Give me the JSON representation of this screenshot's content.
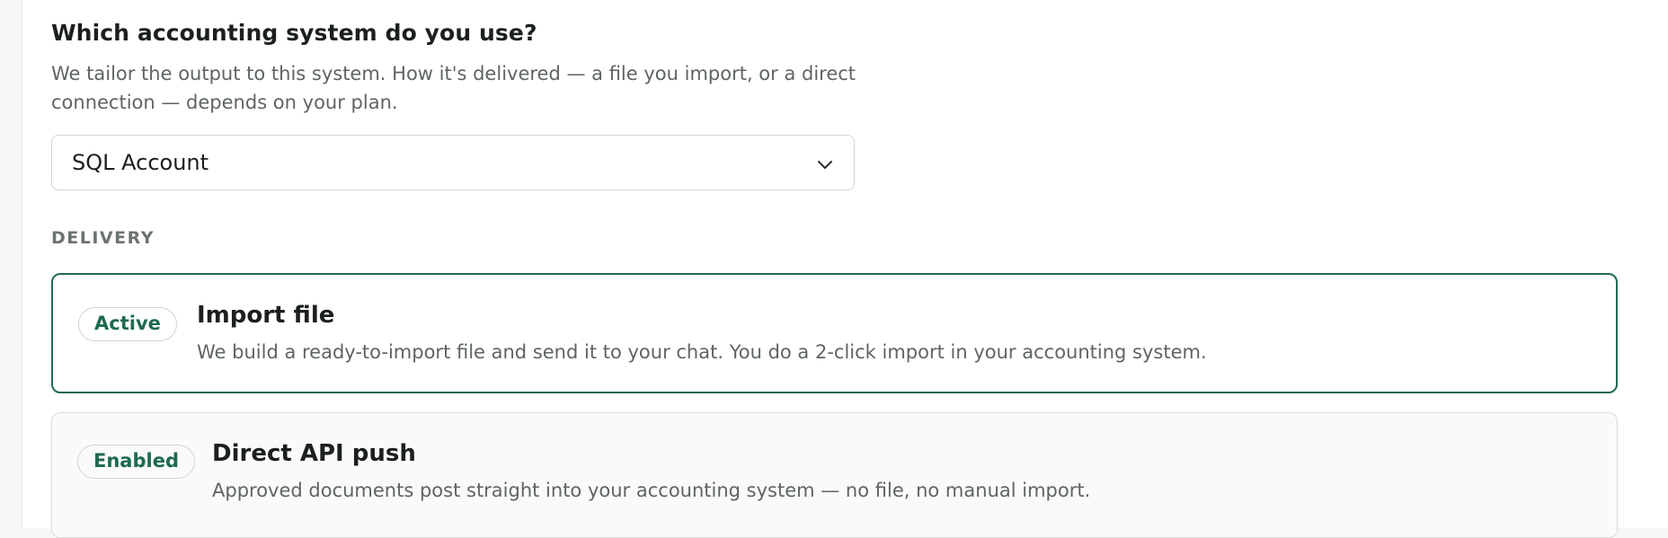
{
  "question": {
    "title": "Which accounting system do you use?",
    "description": "We tailor the output to this system. How it's delivered — a file you import, or a direct connection — depends on your plan."
  },
  "system_select": {
    "selected": "SQL Account",
    "icon": "chevron-down-icon"
  },
  "delivery": {
    "section_label": "DELIVERY",
    "options": [
      {
        "badge": "Active",
        "title": "Import file",
        "description": "We build a ready-to-import file and send it to your chat. You do a 2-click import in your accounting system."
      },
      {
        "badge": "Enabled",
        "title": "Direct API push",
        "description": "Approved documents post straight into your accounting system — no file, no manual import."
      }
    ]
  },
  "colors": {
    "accent": "#1e6a4f",
    "text": "#1b201c",
    "muted": "#5e6560"
  }
}
